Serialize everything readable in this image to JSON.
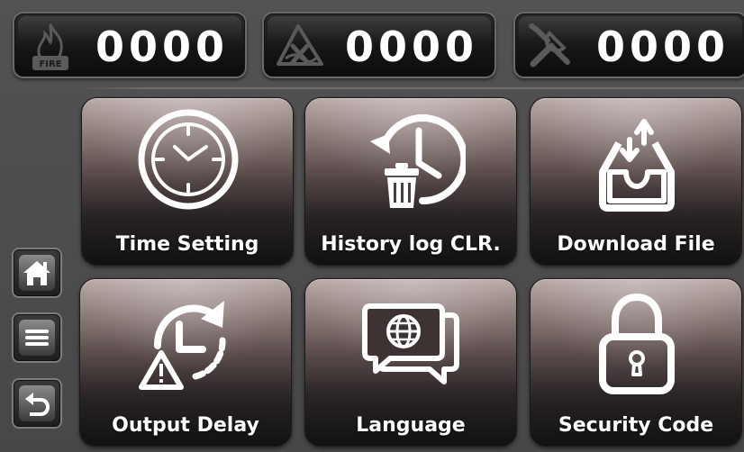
{
  "counters": {
    "fire": {
      "value": "0000",
      "icon": "fire-icon",
      "icon_text": "FIRE"
    },
    "fault": {
      "value": "0000",
      "icon": "fault-icon"
    },
    "maintenance": {
      "value": "0000",
      "icon": "tools-icon"
    }
  },
  "side_nav": [
    {
      "icon": "home-icon"
    },
    {
      "icon": "menu-icon"
    },
    {
      "icon": "back-icon"
    }
  ],
  "tiles": [
    {
      "label": "Time Setting",
      "icon": "clock-icon"
    },
    {
      "label": "History log CLR.",
      "icon": "history-clear-icon"
    },
    {
      "label": "Download File",
      "icon": "download-tray-icon"
    },
    {
      "label": "Output Delay",
      "icon": "output-delay-icon"
    },
    {
      "label": "Language",
      "icon": "language-globe-icon"
    },
    {
      "label": "Security Code",
      "icon": "padlock-icon"
    }
  ],
  "colors": {
    "background": "#4a4a4a",
    "counter_text": "#ffffff",
    "tile_label": "#ffffff",
    "icon_stroke": "#ffffff"
  }
}
